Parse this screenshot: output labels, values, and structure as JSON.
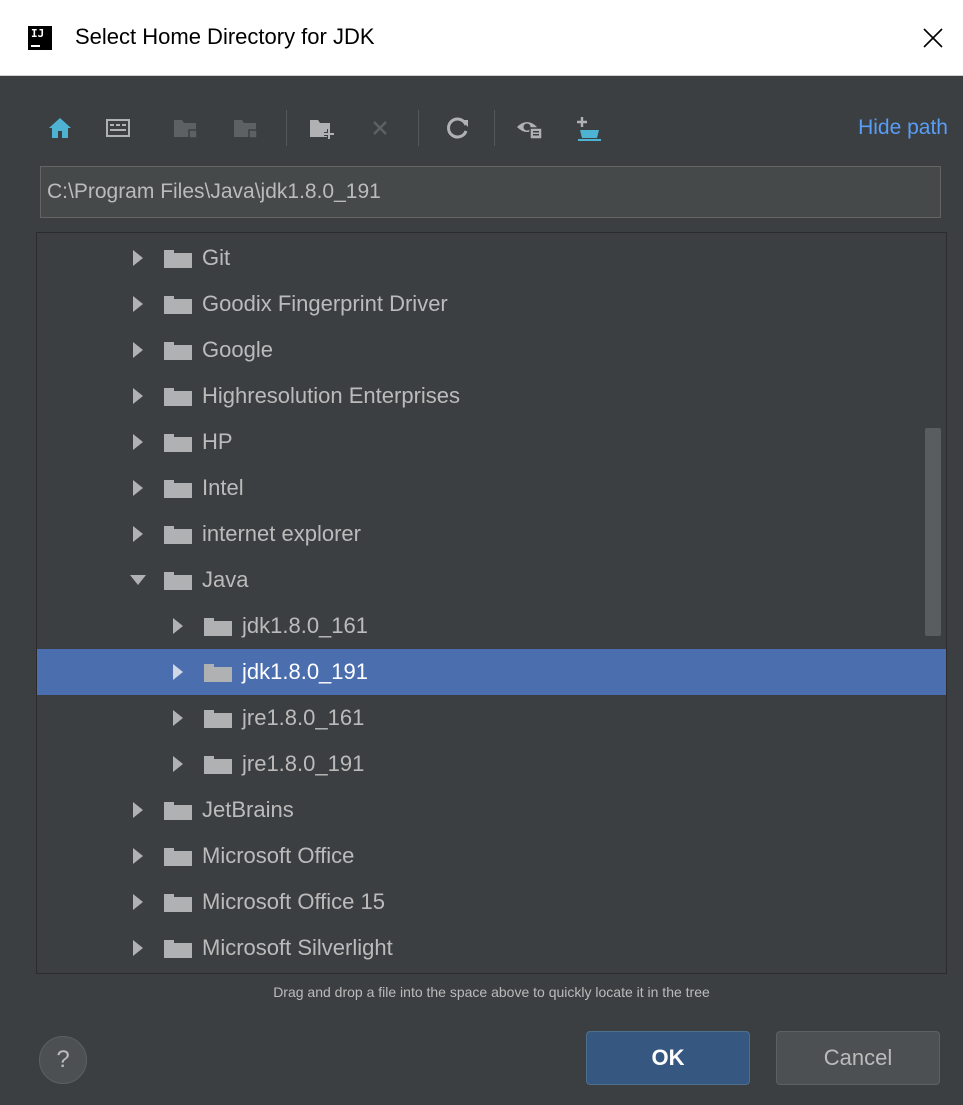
{
  "window": {
    "title": "Select Home Directory for JDK",
    "app_icon_text": "IJ"
  },
  "toolbar": {
    "icons": [
      "home-icon",
      "desktop-icon",
      "project-icon",
      "module-icon",
      "new-folder-icon",
      "delete-icon",
      "refresh-icon",
      "show-hidden-icon",
      "jdk-icon"
    ],
    "hide_path_label": "Hide path"
  },
  "path": {
    "value": "C:\\Program Files\\Java\\jdk1.8.0_191"
  },
  "tree": {
    "items": [
      {
        "label": "Git",
        "level": 1,
        "expanded": false
      },
      {
        "label": "Goodix Fingerprint Driver",
        "level": 1,
        "expanded": false
      },
      {
        "label": "Google",
        "level": 1,
        "expanded": false
      },
      {
        "label": "Highresolution Enterprises",
        "level": 1,
        "expanded": false
      },
      {
        "label": "HP",
        "level": 1,
        "expanded": false
      },
      {
        "label": "Intel",
        "level": 1,
        "expanded": false
      },
      {
        "label": "internet explorer",
        "level": 1,
        "expanded": false
      },
      {
        "label": "Java",
        "level": 1,
        "expanded": true
      },
      {
        "label": "jdk1.8.0_161",
        "level": 2,
        "expanded": false
      },
      {
        "label": "jdk1.8.0_191",
        "level": 2,
        "expanded": false,
        "selected": true
      },
      {
        "label": "jre1.8.0_161",
        "level": 2,
        "expanded": false
      },
      {
        "label": "jre1.8.0_191",
        "level": 2,
        "expanded": false
      },
      {
        "label": "JetBrains",
        "level": 1,
        "expanded": false
      },
      {
        "label": "Microsoft Office",
        "level": 1,
        "expanded": false
      },
      {
        "label": "Microsoft Office 15",
        "level": 1,
        "expanded": false
      },
      {
        "label": "Microsoft Silverlight",
        "level": 1,
        "expanded": false
      }
    ]
  },
  "hint": "Drag and drop a file into the space above to quickly locate it in the tree",
  "buttons": {
    "help": "?",
    "ok": "OK",
    "cancel": "Cancel"
  },
  "colors": {
    "background": "#3c3f41",
    "selection": "#4b6eaf",
    "link": "#589df6",
    "ok_button": "#365880"
  }
}
